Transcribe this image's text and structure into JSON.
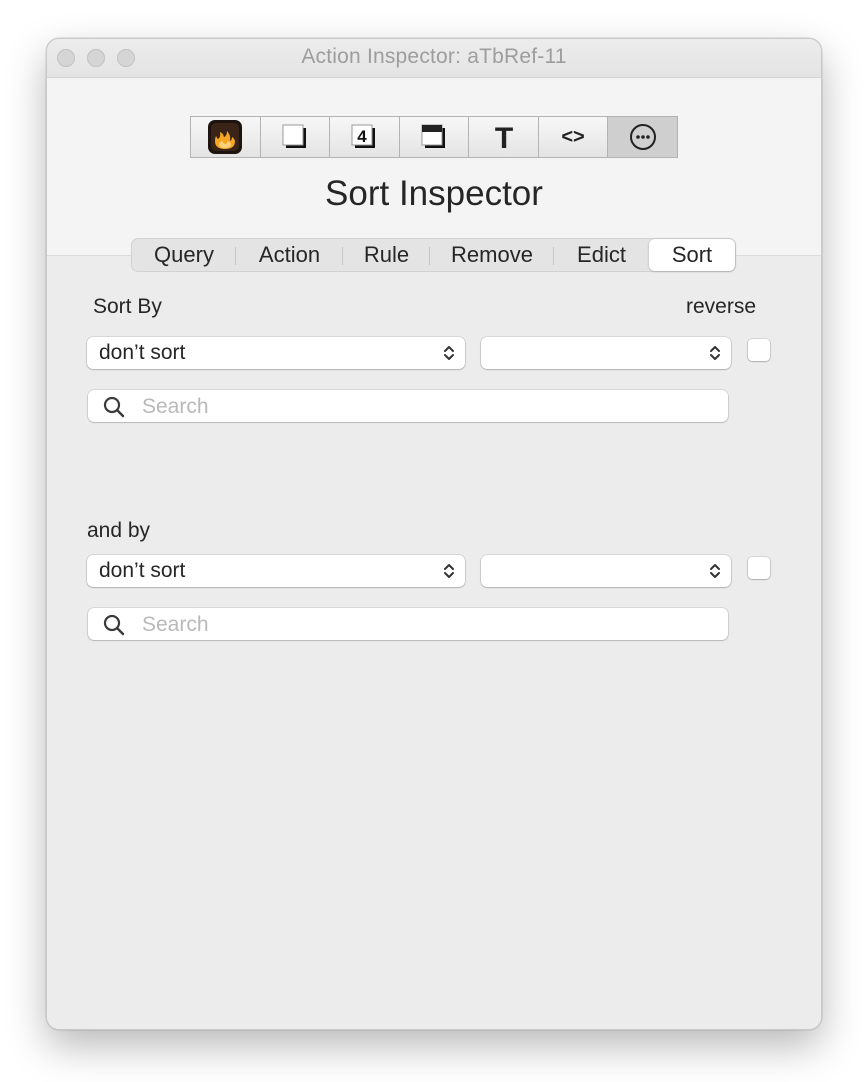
{
  "window": {
    "title": "Action Inspector: aTbRef-11"
  },
  "toolbar": {
    "icons": [
      "action-flame-icon",
      "note-page-icon",
      "number-badge-icon",
      "window-shadow-icon",
      "text-t-icon",
      "code-brackets-icon",
      "more-options-icon"
    ],
    "code_glyph": "<>",
    "text_glyph": "T",
    "number_glyph": "4"
  },
  "inspector": {
    "title": "Sort Inspector"
  },
  "tabs": [
    {
      "label": "Query"
    },
    {
      "label": "Action"
    },
    {
      "label": "Rule"
    },
    {
      "label": "Remove"
    },
    {
      "label": "Edict"
    },
    {
      "label": "Sort",
      "selected": true
    }
  ],
  "sort1": {
    "label": "Sort By",
    "reverse_label": "reverse",
    "attribute_select": "don’t sort",
    "type_select": "",
    "reverse_checked": false,
    "search_placeholder": "Search"
  },
  "sort2": {
    "label": "and by",
    "attribute_select": "don’t sort",
    "type_select": "",
    "reverse_checked": false,
    "search_placeholder": "Search"
  },
  "colors": {
    "window_bg": "#f4f4f4",
    "panel_bg": "#ececec",
    "title_text": "#9d9d9d",
    "placeholder": "#b9b9b9",
    "flame_orange": "#f5a623"
  }
}
